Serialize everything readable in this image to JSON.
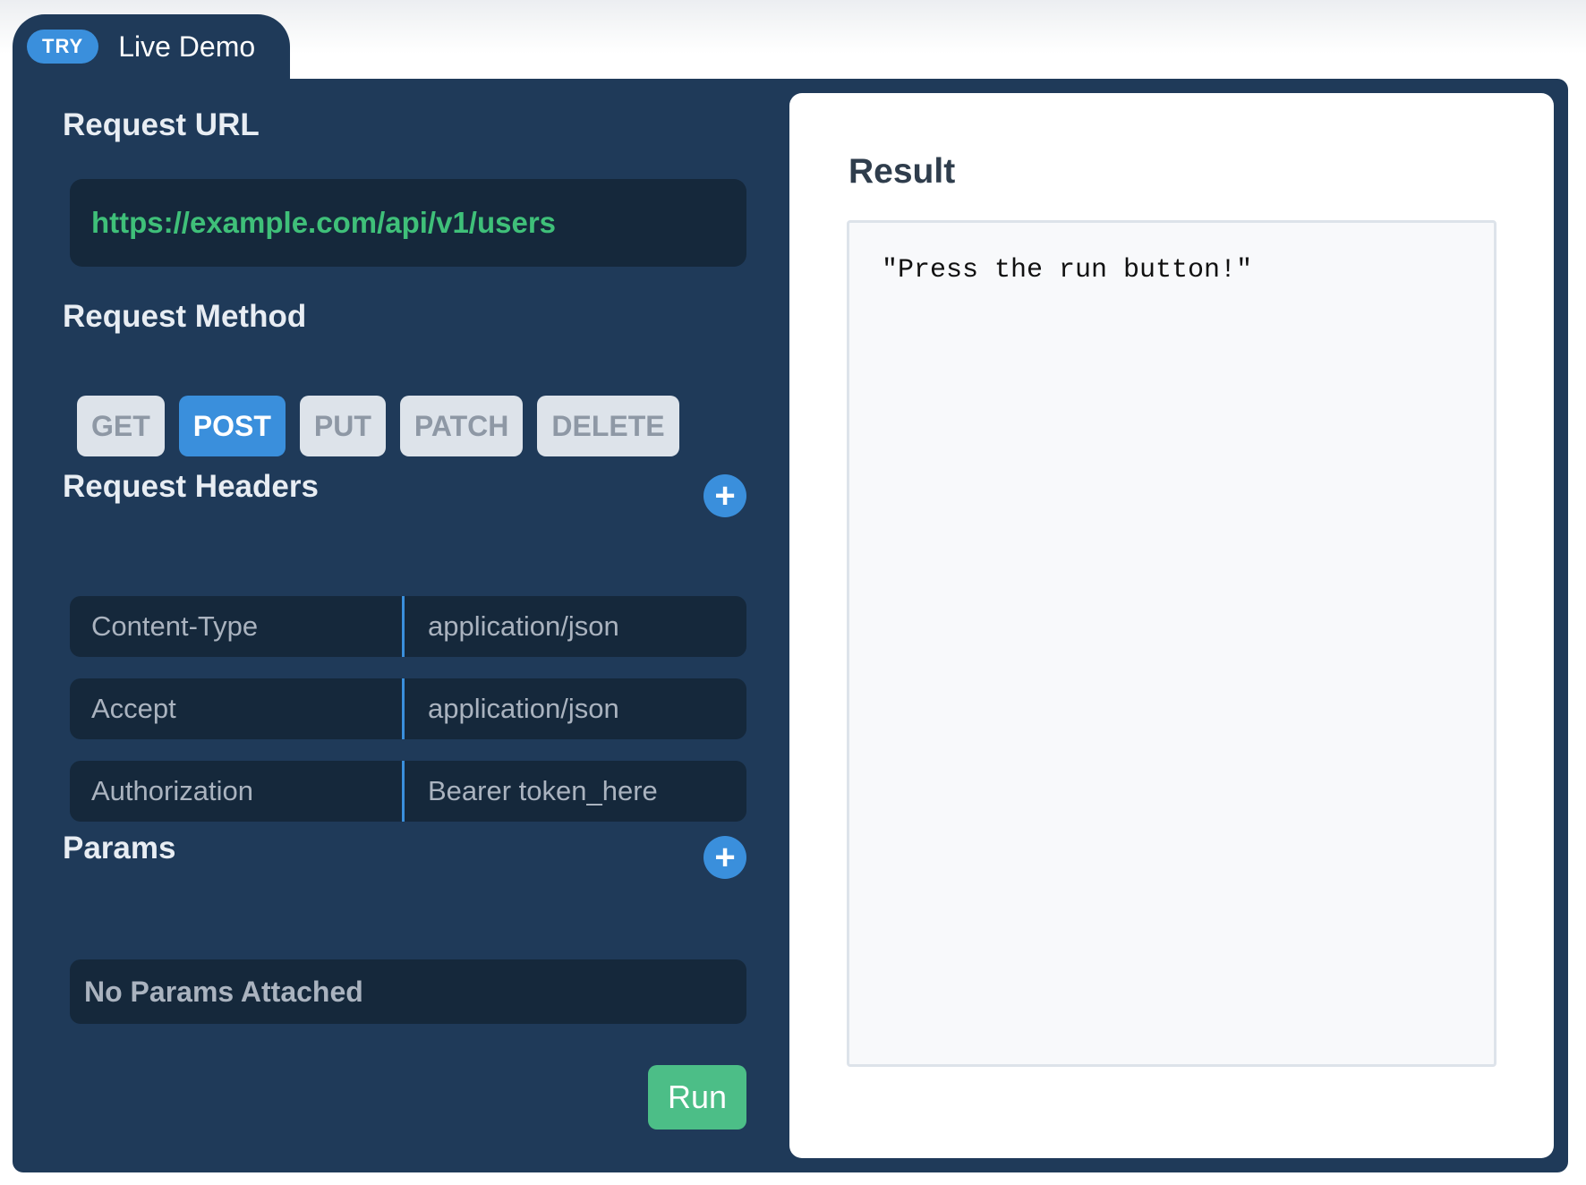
{
  "demo_tab": {
    "badge": "TRY",
    "title": "Live Demo"
  },
  "request_url": {
    "label": "Request URL",
    "value": "https://example.com/api/v1/users"
  },
  "request_method": {
    "label": "Request Method",
    "options": [
      "GET",
      "POST",
      "PUT",
      "PATCH",
      "DELETE"
    ],
    "selected": "POST"
  },
  "request_headers": {
    "label": "Request Headers",
    "add_icon": "plus-icon",
    "rows": [
      {
        "key": "Content-Type",
        "value": "application/json"
      },
      {
        "key": "Accept",
        "value": "application/json"
      },
      {
        "key": "Authorization",
        "value": "Bearer token_here"
      }
    ]
  },
  "params": {
    "label": "Params",
    "add_icon": "plus-icon",
    "empty_text": "No Params Attached"
  },
  "run_button": {
    "label": "Run"
  },
  "result": {
    "title": "Result",
    "output": "\"Press the run button!\""
  },
  "colors": {
    "panel_bg": "#1f3a59",
    "field_bg": "#15283b",
    "accent_blue": "#3a8fdc",
    "url_green": "#3fc079",
    "run_green": "#4cbe87"
  }
}
